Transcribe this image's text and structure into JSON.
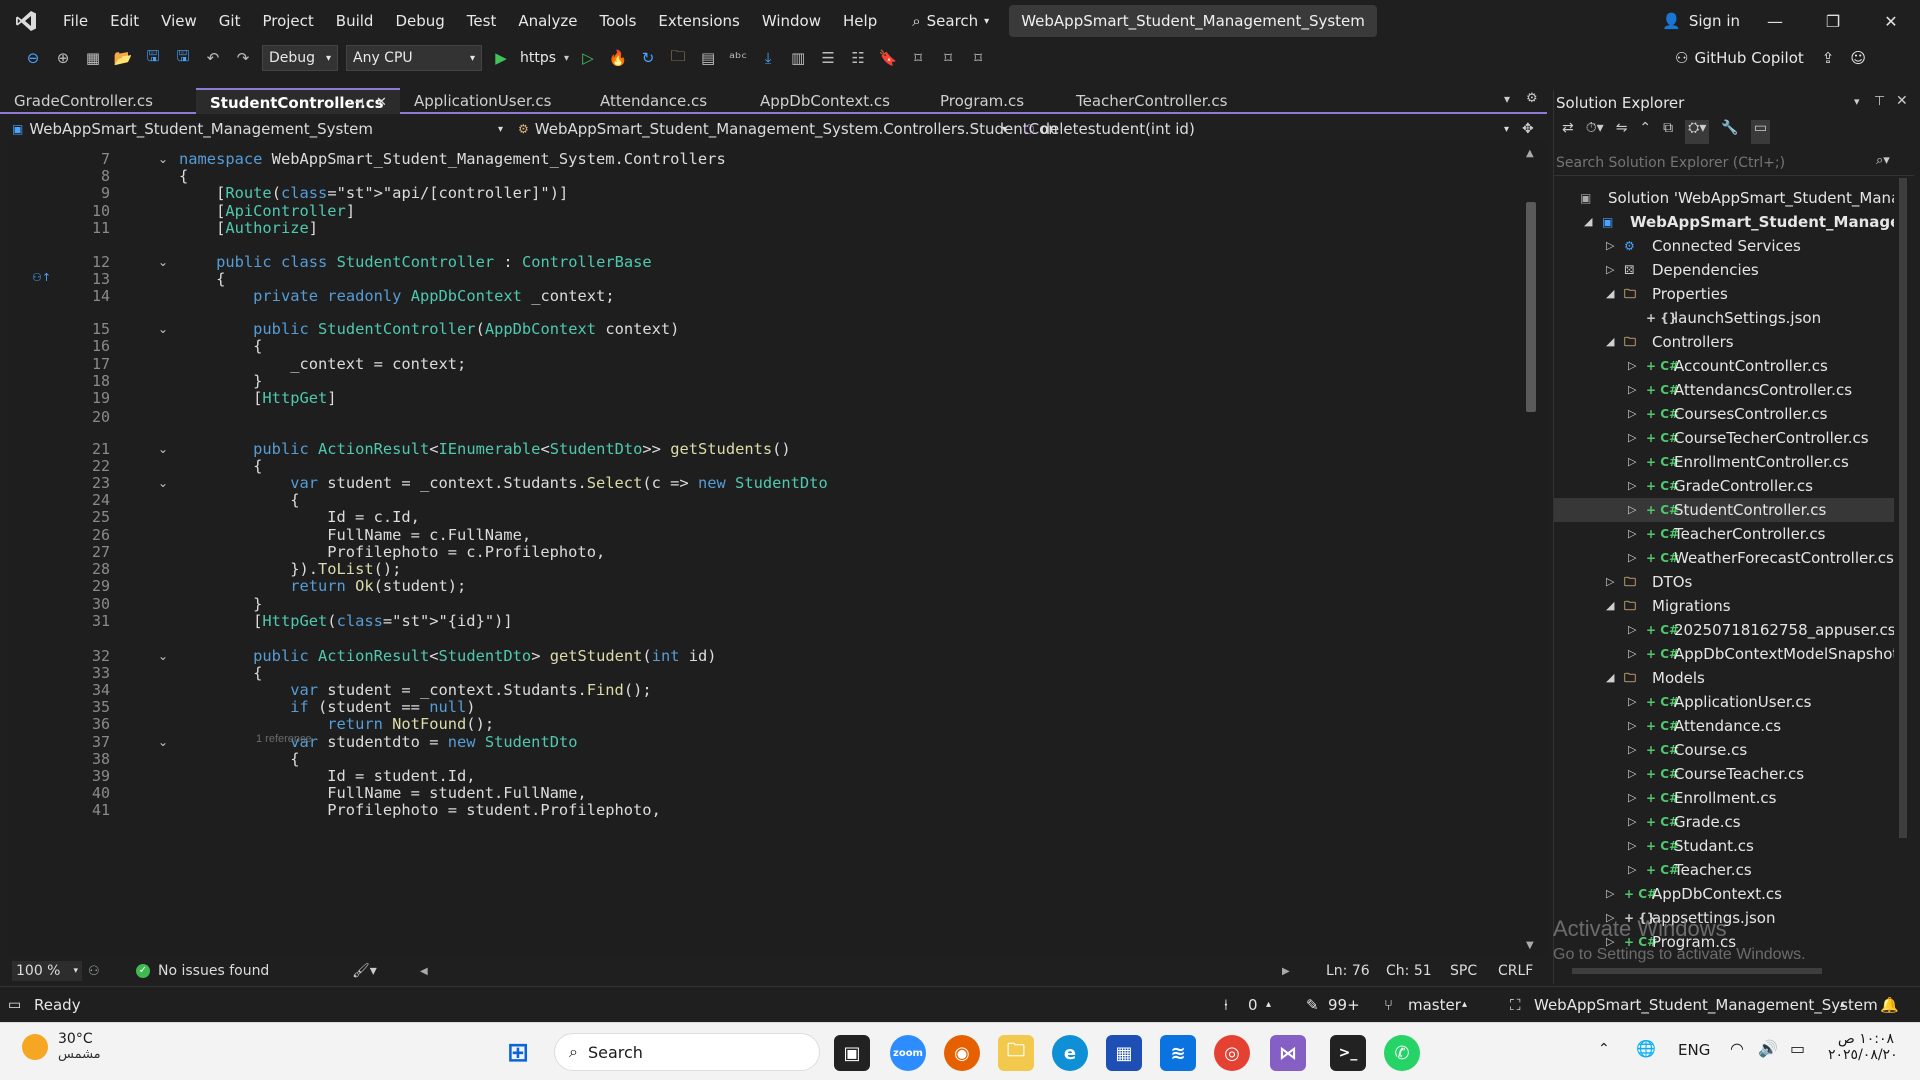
{
  "menu": [
    "File",
    "Edit",
    "View",
    "Git",
    "Project",
    "Build",
    "Debug",
    "Test",
    "Analyze",
    "Tools",
    "Extensions",
    "Window",
    "Help"
  ],
  "search_label": "Search",
  "solution_title": "WebAppSmart_Student_Management_System",
  "signin_label": "Sign in",
  "toolbar": {
    "config": "Debug",
    "platform": "Any CPU",
    "run_target": "https",
    "copilot": "GitHub Copilot"
  },
  "tabs": [
    "GradeController.cs",
    "StudentController.cs",
    "ApplicationUser.cs",
    "Attendance.cs",
    "AppDbContext.cs",
    "Program.cs",
    "TeacherController.cs"
  ],
  "navbar": {
    "project": "WebAppSmart_Student_Management_System",
    "class": "WebAppSmart_Student_Management_System.Controllers.StudentCon",
    "member": "deletestudent(int id)"
  },
  "code": [
    {
      "n": "7",
      "t": "namespace WebAppSmart_Student_Management_System.Controllers"
    },
    {
      "n": "8",
      "t": "{"
    },
    {
      "n": "9",
      "t": "    [Route(\"api/[controller]\")]"
    },
    {
      "n": "10",
      "t": "    [ApiController]"
    },
    {
      "n": "11",
      "t": "    [Authorize]"
    },
    {
      "n": "12",
      "t": "    public class StudentController : ControllerBase"
    },
    {
      "n": "13",
      "t": "    {"
    },
    {
      "n": "14",
      "t": "        private readonly AppDbContext _context;"
    },
    {
      "n": "15",
      "t": "        public StudentController(AppDbContext context)"
    },
    {
      "n": "16",
      "t": "        {"
    },
    {
      "n": "17",
      "t": "            _context = context;"
    },
    {
      "n": "18",
      "t": "        }"
    },
    {
      "n": "19",
      "t": "        [HttpGet]"
    },
    {
      "n": "20",
      "t": ""
    },
    {
      "n": "21",
      "t": "        public ActionResult<IEnumerable<StudentDto>> getStudents()"
    },
    {
      "n": "22",
      "t": "        {"
    },
    {
      "n": "23",
      "t": "            var student = _context.Studants.Select(c => new StudentDto"
    },
    {
      "n": "24",
      "t": "            {"
    },
    {
      "n": "25",
      "t": "                Id = c.Id,"
    },
    {
      "n": "26",
      "t": "                FullName = c.FullName,"
    },
    {
      "n": "27",
      "t": "                Profilephoto = c.Profilephoto,"
    },
    {
      "n": "28",
      "t": "            }).ToList();"
    },
    {
      "n": "29",
      "t": "            return Ok(student);"
    },
    {
      "n": "30",
      "t": "        }"
    },
    {
      "n": "31",
      "t": "        [HttpGet(\"{id}\")]"
    },
    {
      "n": "32",
      "t": "        public ActionResult<StudentDto> getStudent(int id)"
    },
    {
      "n": "33",
      "t": "        {"
    },
    {
      "n": "34",
      "t": "            var student = _context.Studants.Find();"
    },
    {
      "n": "35",
      "t": "            if (student == null)"
    },
    {
      "n": "36",
      "t": "                return NotFound();"
    },
    {
      "n": "37",
      "t": "            var studentdto = new StudentDto"
    },
    {
      "n": "38",
      "t": "            {"
    },
    {
      "n": "39",
      "t": "                Id = student.Id,"
    },
    {
      "n": "40",
      "t": "                FullName = student.FullName,"
    },
    {
      "n": "41",
      "t": "                Profilephoto = student.Profilephoto,"
    }
  ],
  "codelens_reference": "1 reference",
  "editor_status": {
    "zoom": "100 %",
    "issues": "No issues found",
    "ln": "Ln: 76",
    "ch": "Ch: 51",
    "spc": "SPC",
    "crlf": "CRLF"
  },
  "solution_explorer": {
    "title": "Solution Explorer",
    "search_placeholder": "Search Solution Explorer (Ctrl+;)",
    "items": [
      {
        "label": "Solution 'WebAppSmart_Student_Manageme",
        "icon": "solution-icon"
      },
      {
        "label": "WebAppSmart_Student_Management_S",
        "icon": "project-icon"
      },
      {
        "label": "Connected Services",
        "icon": "connected-services-icon"
      },
      {
        "label": "Dependencies",
        "icon": "dependencies-icon"
      },
      {
        "label": "Properties",
        "icon": "folder-icon"
      },
      {
        "label": "launchSettings.json",
        "icon": "json-icon"
      },
      {
        "label": "Controllers",
        "icon": "folder-icon"
      },
      {
        "label": "AccountController.cs",
        "icon": "csharp-icon"
      },
      {
        "label": "AttendancsController.cs",
        "icon": "csharp-icon"
      },
      {
        "label": "CoursesController.cs",
        "icon": "csharp-icon"
      },
      {
        "label": "CourseTecherController.cs",
        "icon": "csharp-icon"
      },
      {
        "label": "EnrollmentController.cs",
        "icon": "csharp-icon"
      },
      {
        "label": "GradeController.cs",
        "icon": "csharp-icon"
      },
      {
        "label": "StudentController.cs",
        "icon": "csharp-icon"
      },
      {
        "label": "TeacherController.cs",
        "icon": "csharp-icon"
      },
      {
        "label": "WeatherForecastController.cs",
        "icon": "csharp-icon"
      },
      {
        "label": "DTOs",
        "icon": "folder-icon"
      },
      {
        "label": "Migrations",
        "icon": "folder-icon"
      },
      {
        "label": "20250718162758_appuser.cs",
        "icon": "csharp-icon"
      },
      {
        "label": "AppDbContextModelSnapshot.cs",
        "icon": "csharp-icon"
      },
      {
        "label": "Models",
        "icon": "folder-icon"
      },
      {
        "label": "ApplicationUser.cs",
        "icon": "csharp-icon"
      },
      {
        "label": "Attendance.cs",
        "icon": "csharp-icon"
      },
      {
        "label": "Course.cs",
        "icon": "csharp-icon"
      },
      {
        "label": "CourseTeacher.cs",
        "icon": "csharp-icon"
      },
      {
        "label": "Enrollment.cs",
        "icon": "csharp-icon"
      },
      {
        "label": "Grade.cs",
        "icon": "csharp-icon"
      },
      {
        "label": "Studant.cs",
        "icon": "csharp-icon"
      },
      {
        "label": "Teacher.cs",
        "icon": "csharp-icon"
      },
      {
        "label": "AppDbContext.cs",
        "icon": "csharp-icon"
      },
      {
        "label": "appsettings.json",
        "icon": "json-icon"
      },
      {
        "label": "Program.cs",
        "icon": "csharp-icon"
      }
    ]
  },
  "watermark": {
    "line1": "Activate Windows",
    "line2": "Go to Settings to activate Windows."
  },
  "statusbar": {
    "ready": "Ready",
    "errors": "0",
    "edits": "99+",
    "branch": "master",
    "project": "WebAppSmart_Student_Management_System"
  },
  "taskbar": {
    "temp": "30°C",
    "weather": "مشمس",
    "search": "Search",
    "lang": "ENG",
    "time": "١٠:٠٨ ص",
    "date": "٢٠٢٥/٠٨/٢٠"
  },
  "colors": {
    "accent": "#8f7ad8",
    "bg": "#1f1f1f",
    "editor_bg": "#1e1e1e",
    "keyword": "#569cd6",
    "type": "#4ec9b0",
    "string": "#d69d85",
    "method": "#dcdcaa"
  }
}
